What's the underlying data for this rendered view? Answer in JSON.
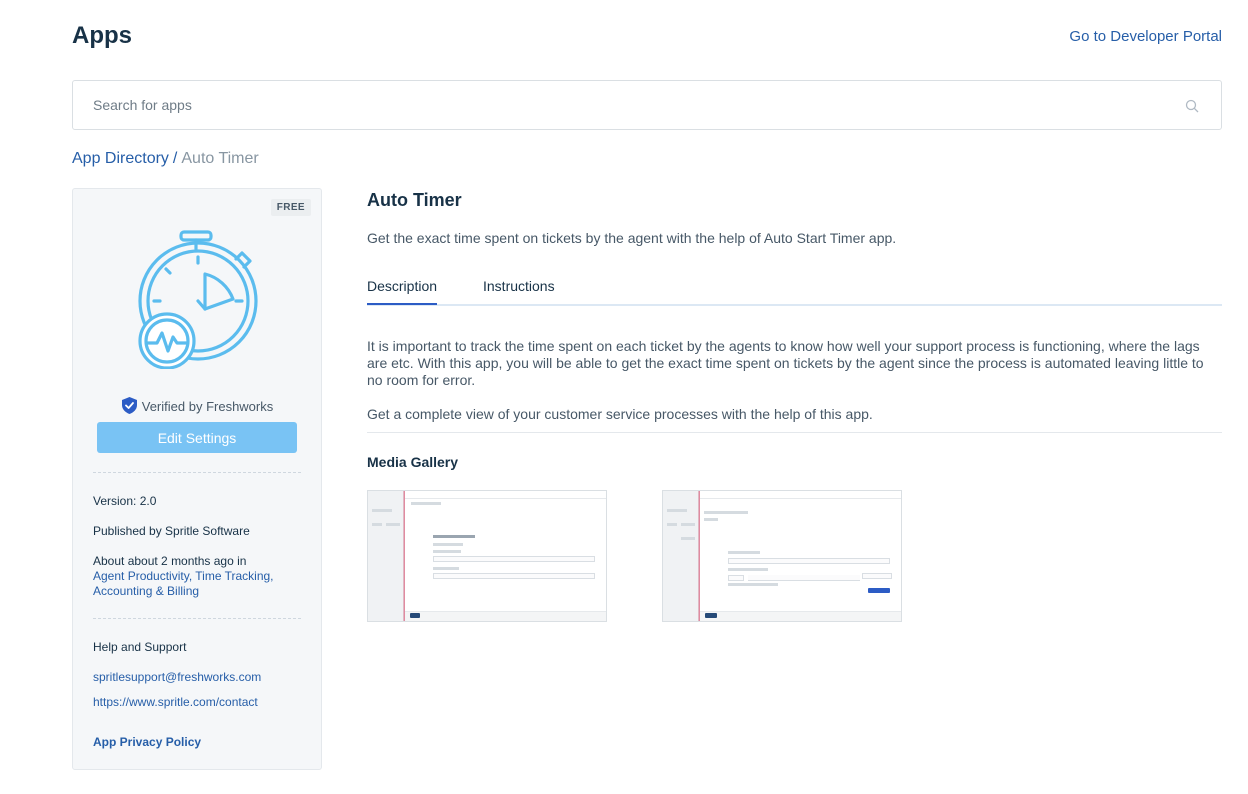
{
  "header": {
    "title": "Apps",
    "developer_portal_link": "Go to Developer Portal"
  },
  "search": {
    "placeholder": "Search for apps",
    "value": ""
  },
  "breadcrumb": {
    "parent": "App Directory",
    "separator": "/",
    "current": "Auto Timer"
  },
  "app_card": {
    "badge": "FREE",
    "logo_icon": "stopwatch-heartbeat-icon",
    "verified_text": "Verified by Freshworks",
    "edit_button": "Edit Settings",
    "version": "Version: 2.0",
    "publisher": "Published by Spritle Software",
    "about_prefix": "About about 2 months ago in",
    "categories": "Agent Productivity, Time Tracking, Accounting & Billing",
    "support_heading": "Help and Support",
    "support_email": "spritlesupport@freshworks.com",
    "support_url": "https://www.spritle.com/contact",
    "privacy_policy": "App Privacy Policy"
  },
  "main": {
    "app_name": "Auto Timer",
    "tagline": "Get the exact time spent on tickets by the agent with the help of Auto Start Timer app.",
    "tabs": [
      {
        "label": "Description",
        "active": true
      },
      {
        "label": "Instructions",
        "active": false
      }
    ],
    "description": [
      "It is important to track the time spent on each ticket by the agents to know how well your support process is functioning, where the lags are etc. With this app, you will be able to get the exact time spent on tickets by the agent since the process is automated leaving little to no room for error.",
      "Get a complete view of your customer service processes with the help of this app."
    ],
    "media_gallery_title": "Media Gallery"
  },
  "colors": {
    "link": "#265ea8",
    "text": "#183247",
    "button": "#79c3f4",
    "tab_active": "#2c5cc5",
    "icon_blue": "#5bbcee",
    "verified_shield": "#2c5cc5"
  }
}
